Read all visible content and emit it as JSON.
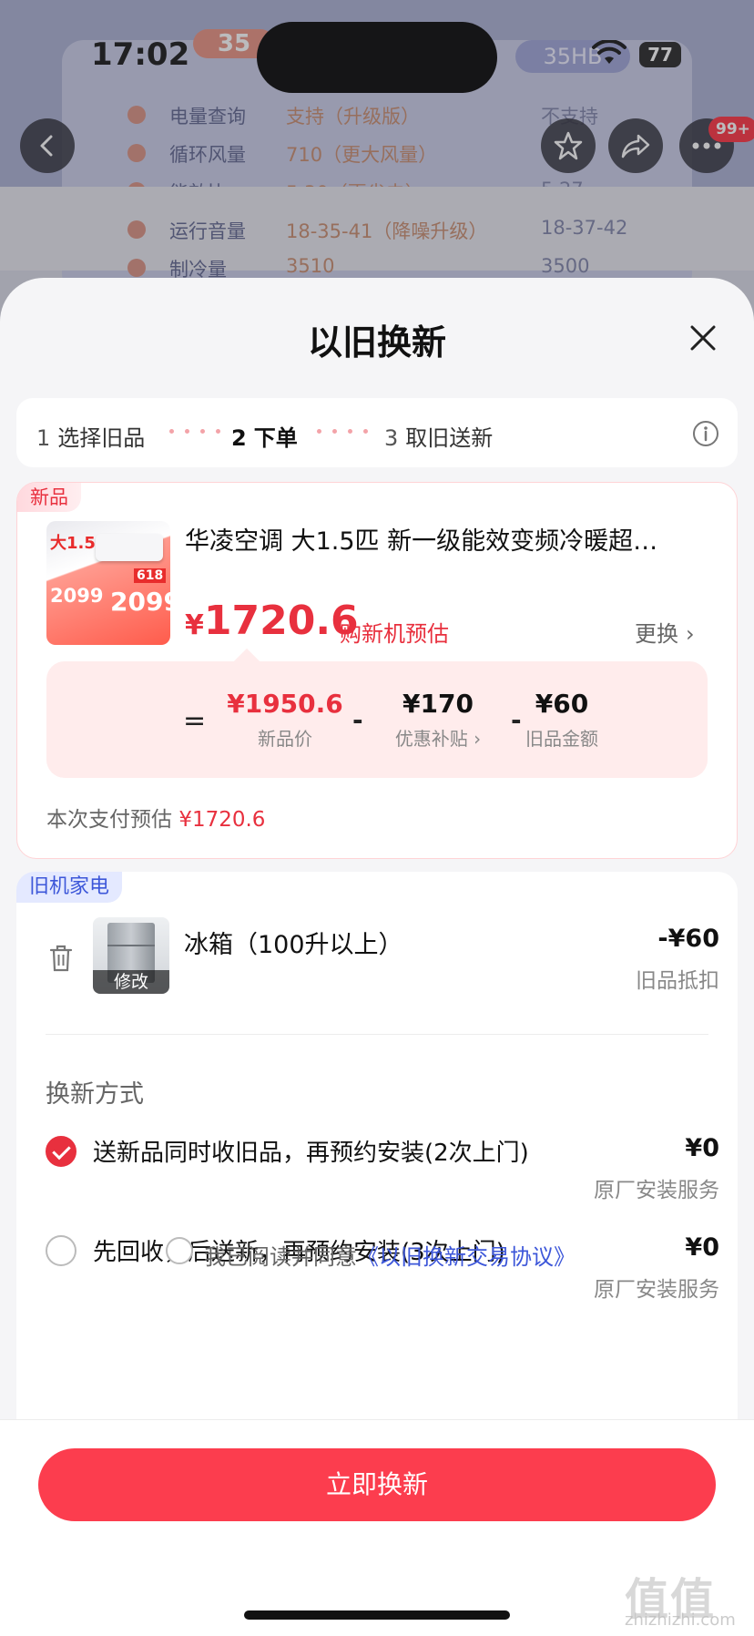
{
  "status_bar": {
    "time": "17:02",
    "battery": "77"
  },
  "background": {
    "badge_left": "35",
    "badge_right": "35HB",
    "rows": [
      {
        "k": "电量查询",
        "v": "支持（升级版）",
        "v2": "不支持"
      },
      {
        "k": "循环风量",
        "v": "710（更大风量）",
        "v2": ""
      },
      {
        "k": "能效比",
        "v": "5.30（更省电）",
        "v2": "5.27"
      },
      {
        "k": "运行音量",
        "v": "18-35-41（降噪升级）",
        "v2": "18-37-42"
      },
      {
        "k": "制冷量",
        "v": "3510",
        "v2": "3500"
      }
    ],
    "notif_count": "99+"
  },
  "sheet": {
    "title": "以旧换新",
    "steps": [
      {
        "num": "1",
        "label": "选择旧品"
      },
      {
        "num": "2",
        "label": "下单"
      },
      {
        "num": "3",
        "label": "取旧送新"
      }
    ],
    "new_product": {
      "tag": "新品",
      "title": "华凌空调 大1.5匹 新一级能效变频冷暖超…",
      "img_text": {
        "p1": "2099",
        "p2": "2099",
        "p3": "大1.5",
        "p4": "618"
      },
      "est_currency": "¥",
      "est_amount": "1720.6",
      "est_label": "购新机预估",
      "change_label": "更换",
      "calc": {
        "eq": "=",
        "new_price": "¥1950.6",
        "new_price_label": "新品价",
        "subsidy": "¥170",
        "subsidy_label": "优惠补贴 ›",
        "old_value": "¥60",
        "old_value_label": "旧品金额"
      },
      "pay_est_label": "本次支付预估",
      "pay_est_value": "¥1720.6"
    },
    "old_appliance": {
      "tag": "旧机家电",
      "name": "冰箱（100升以上）",
      "edit_label": "修改",
      "amount": "-¥60",
      "amount_label": "旧品抵扣",
      "method_label": "换新方式",
      "options": [
        {
          "text": "送新品同时收旧品，再预约安装(2次上门)",
          "price": "¥0",
          "sub": "原厂安装服务",
          "checked": true
        },
        {
          "text": "先回收，后送新，再预约安装(3次上门)",
          "price": "¥0",
          "sub": "原厂安装服务",
          "checked": false
        }
      ]
    },
    "agreement": {
      "text": "我已阅读并同意",
      "link": "《以旧换新交易协议》"
    },
    "cta": "立即换新"
  },
  "watermark": {
    "main": "值值值",
    "sub": "zhizhizhi.com"
  }
}
